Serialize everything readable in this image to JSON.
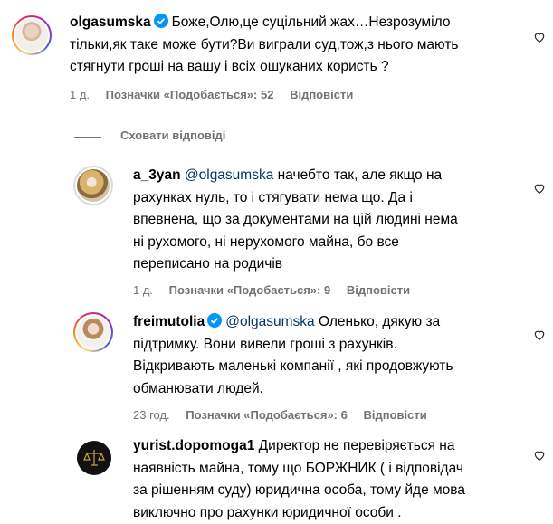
{
  "comments": [
    {
      "username": "olgasumska",
      "verified": true,
      "text": "Боже,Олю,це суцільний жах…Незрозуміло тільки,як таке може бути?Ви виграли суд,тож,з нього мають стягнути гроші на вашу і всіх ошуканих користь ?",
      "line1": "Боже,Олю,це суцільний жах…Незрозуміло",
      "line2": "тільки,як таке може бути?Ви виграли суд,тож,з нього мають",
      "line3": "стягнути гроші на вашу і всіх ошуканих користь ?",
      "time": "1 д.",
      "likes": "Позначки «Подобається»: 52",
      "reply": "Відповісти"
    },
    {
      "username": "a_3yan",
      "mention": "@olgasumska",
      "line1": "начебто так, але якщо на",
      "line2": "рахунках нуль, то і стягувати нема що. Да і",
      "line3": "впевнена, що за документами на цій людині нема",
      "line4": "ні рухомого, ні нерухомого майна, бо все",
      "line5": "переписано на родичів",
      "time": "1 д.",
      "likes": "Позначки «Подобається»: 9",
      "reply": "Відповісти"
    },
    {
      "username": "freimutolia",
      "verified": true,
      "mention": "@olgasumska",
      "line1": "Оленько, дякую за",
      "line2": "підтримку. Вони вивели гроші з рахунків.",
      "line3": "Відкривають маленькі компанії , які продовжують",
      "line4": "обманювати людей.",
      "time": "23 год.",
      "likes": "Позначки «Подобається»: 6",
      "reply": "Відповісти"
    },
    {
      "username": "yurist.dopomoga1",
      "line1": "Директор не перевіряється на",
      "line2": "наявність майна, тому що БОРЖНИК ( і відповідач",
      "line3": "за рішенням суду) юридична особа, тому йде мова",
      "line4": "виключно про рахунки юридичної особи ."
    }
  ],
  "hide_replies": "Сховати відповіді",
  "colors": {
    "meta": "#737373",
    "mention": "#00376b",
    "verified": "#0095f6"
  }
}
